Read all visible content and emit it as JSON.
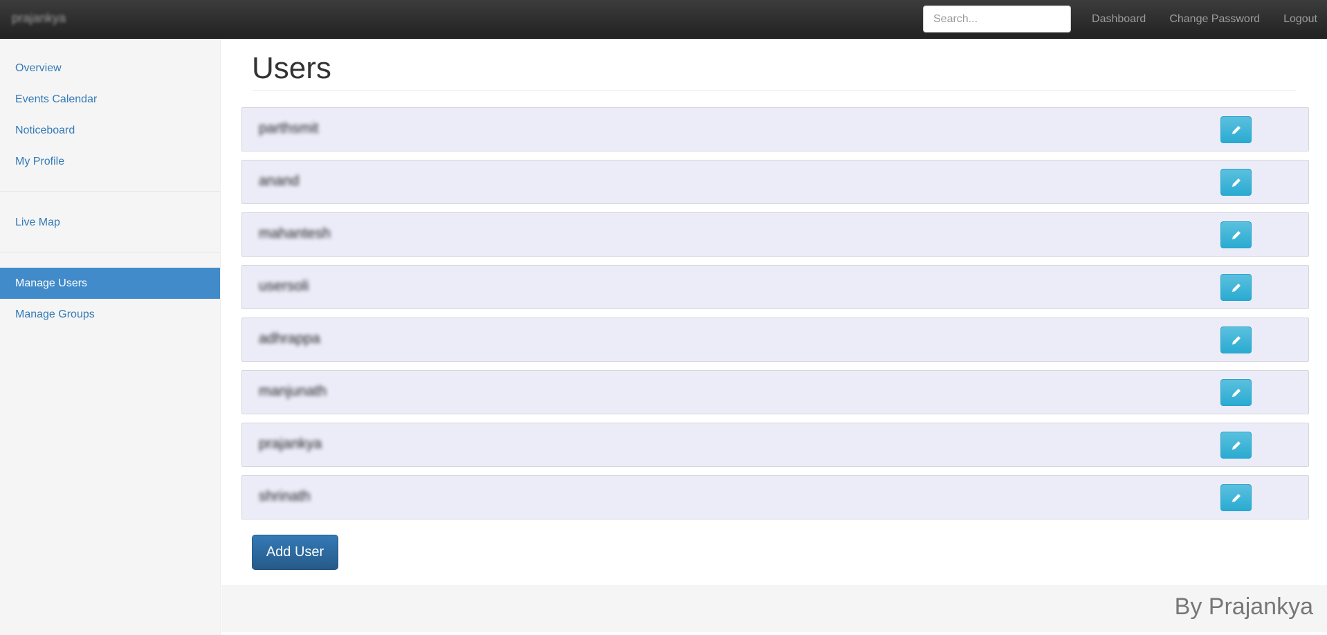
{
  "navbar": {
    "brand": "prajankya",
    "search_placeholder": "Search...",
    "links": [
      "Dashboard",
      "Change Password",
      "Logout"
    ]
  },
  "sidebar": {
    "group1": [
      "Overview",
      "Events Calendar",
      "Noticeboard",
      "My Profile"
    ],
    "group2": [
      "Live Map"
    ],
    "group3": [
      "Manage Users",
      "Manage Groups"
    ],
    "active": "Manage Users"
  },
  "main": {
    "title": "Users",
    "users": [
      "parthsmit",
      "anand",
      "mahantesh",
      "usersoli",
      "adhrappa",
      "manjunath",
      "prajankya",
      "shrinath"
    ],
    "edit_icon": "pencil-icon",
    "add_button": "Add User"
  },
  "footer": {
    "text": "By Prajankya"
  },
  "colors": {
    "accent": "#428bca",
    "edit_button": "#5bc0de",
    "row_bg": "#ececf9",
    "add_button": "#337ab7"
  }
}
